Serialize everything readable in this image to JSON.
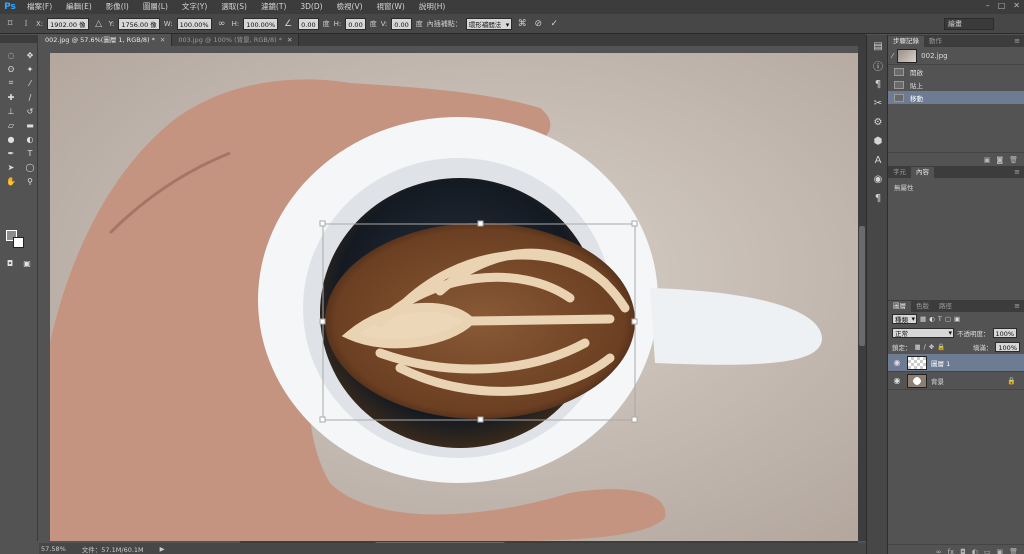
{
  "app": {
    "logo": "Ps"
  },
  "menu": [
    "檔案(F)",
    "編輯(E)",
    "影像(I)",
    "圖層(L)",
    "文字(Y)",
    "選取(S)",
    "濾鏡(T)",
    "3D(D)",
    "檢視(V)",
    "視窗(W)",
    "說明(H)"
  ],
  "options": {
    "x_label": "X:",
    "x_value": "1902.00 像",
    "y_label": "Y:",
    "y_value": "1756.00 像",
    "w_label": "W:",
    "w_value": "100.00%",
    "h_label": "H:",
    "h_value": "100.00%",
    "angle_value": "0.00",
    "angle_unit": "度",
    "hskew_label": "H:",
    "hskew_value": "0.00",
    "hskew_unit": "度",
    "vskew_label": "V:",
    "vskew_value": "0.00",
    "vskew_unit": "度",
    "interp_label": "內插補點：",
    "interp_value": "環形補間法",
    "workspace_value": "繪畫"
  },
  "tabs": [
    {
      "label": "002.jpg @ 57.6%(圖層 1, RGB/8) *",
      "active": true
    },
    {
      "label": "003.jpg @ 100% (背景, RGB/8) *",
      "active": false
    }
  ],
  "status": {
    "zoom": "57.58%",
    "doc_info": "文件：57.1M/60.1M"
  },
  "history": {
    "tabs": [
      "步驟記錄",
      "動作"
    ],
    "snapshot": "002.jpg",
    "items": [
      {
        "label": "開啟",
        "active": false
      },
      {
        "label": "貼上",
        "active": false
      },
      {
        "label": "移動",
        "active": true
      }
    ]
  },
  "properties": {
    "tabs": [
      "字元",
      "內容"
    ],
    "empty_text": "無屬性"
  },
  "layers": {
    "tabs": [
      "圖層",
      "色版",
      "路徑"
    ],
    "filter": "種類",
    "blend_mode": "正常",
    "opacity_label": "不透明度：",
    "opacity_value": "100%",
    "lock_label": "鎖定：",
    "fill_label": "填滿：",
    "fill_value": "100%",
    "items": [
      {
        "name": "圖層 1",
        "active": true
      },
      {
        "name": "背景",
        "active": false
      }
    ]
  }
}
